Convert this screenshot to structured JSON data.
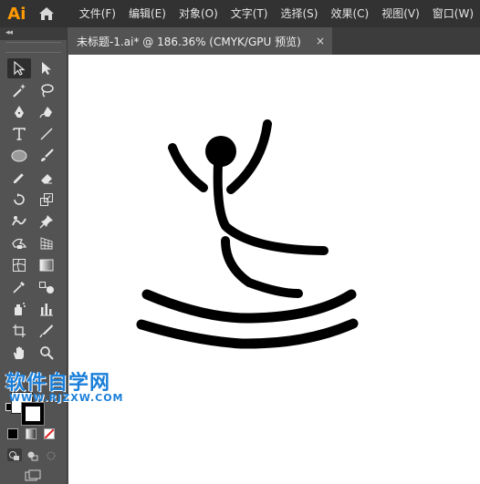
{
  "app": {
    "logo_text": "Ai"
  },
  "menu": {
    "items": [
      "文件(F)",
      "编辑(E)",
      "对象(O)",
      "文字(T)",
      "选择(S)",
      "效果(C)",
      "视图(V)",
      "窗口(W)"
    ]
  },
  "tab": {
    "title": "未标题-1.ai* @ 186.36% (CMYK/GPU 预览)",
    "close_glyph": "×"
  },
  "tools_panel": {
    "collapse_glyph": "◂◂",
    "tools": [
      "selection-tool",
      "direct-selection-tool",
      "magic-wand-tool",
      "lasso-tool",
      "pen-tool",
      "curvature-tool",
      "type-tool",
      "line-segment-tool",
      "ellipse-tool",
      "paintbrush-tool",
      "pencil-tool",
      "eraser-tool",
      "rotate-tool",
      "scale-tool",
      "puppet-warp-tool",
      "pin-tool",
      "free-transform-tool",
      "perspective-grid-tool",
      "mesh-tool",
      "gradient-tool",
      "eyedropper-tool",
      "blend-tool",
      "symbol-sprayer-tool",
      "column-graph-tool",
      "artboard-tool",
      "slice-tool",
      "hand-tool",
      "zoom-tool"
    ],
    "fill_color": "#ffffff",
    "stroke_color": "#000000"
  },
  "colors": {
    "menubar_bg": "#323232",
    "panel_bg": "#535353",
    "canvas_bg": "#ffffff",
    "logo_color": "#ff9a00",
    "watermark_color": "#1b7fd9"
  },
  "watermark": {
    "title": "软件自学网",
    "url": "WWW.RJZXW.COM"
  }
}
